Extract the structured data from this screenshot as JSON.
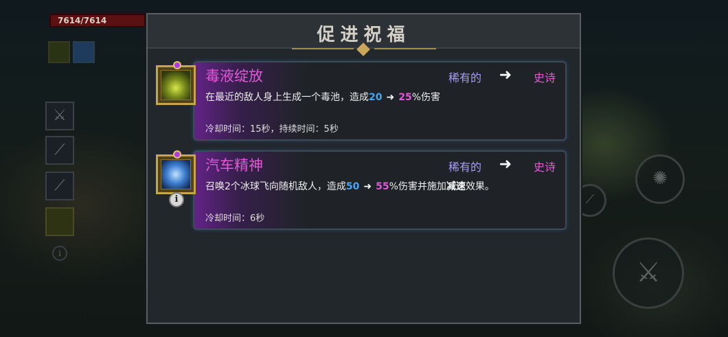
{
  "hud": {
    "hp_text": "7614/7614"
  },
  "modal": {
    "title": "促进祝福",
    "cards": [
      {
        "name": "毒液绽放",
        "rarity_from": "稀有的",
        "arrow": "➜",
        "rarity_to": "史诗",
        "desc_prefix": "在最近的敌人身上生成一个毒池，造成",
        "value_from": "20",
        "desc_arrow": "➜",
        "value_to": "25",
        "desc_suffix": "%伤害",
        "cooldown": "冷却时间：15秒，持续时间：5秒",
        "icon": "poison-bloom-icon"
      },
      {
        "name": "汽车精神",
        "rarity_from": "稀有的",
        "arrow": "➜",
        "rarity_to": "史诗",
        "desc_prefix": "召唤2个冰球飞向随机敌人，造成",
        "value_from": "50",
        "desc_arrow": "➜",
        "value_to": "55",
        "desc_middle": "%伤害并施加",
        "desc_bold": "减速",
        "desc_suffix": "效果。",
        "cooldown": "冷却时间：6秒",
        "icon": "frost-spirit-icon"
      }
    ],
    "info_label": "i"
  },
  "colors": {
    "rare": "#a89cf5",
    "epic": "#e05ad8",
    "value_old": "#4aa6f0",
    "frame_gold": "#c7a649"
  }
}
